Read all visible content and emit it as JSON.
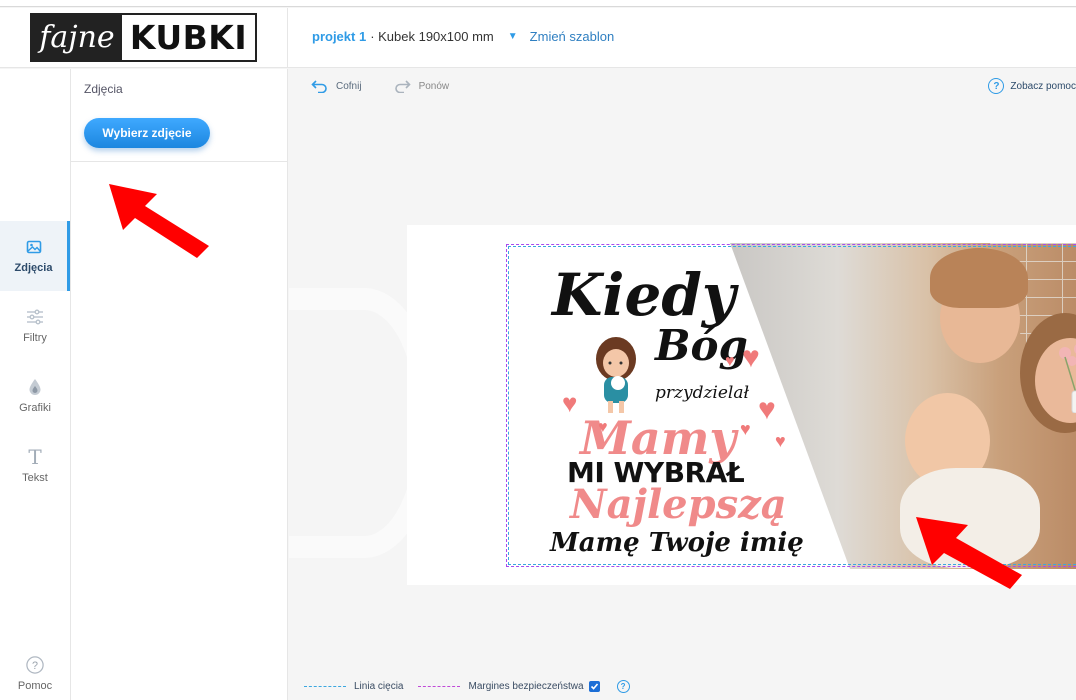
{
  "brand": {
    "logo_left": "fajne",
    "logo_right": "KUBKI"
  },
  "header": {
    "project_name": "projekt 1",
    "product": "· Kubek 190x100 mm",
    "change_template": "Zmień szablon"
  },
  "rail": {
    "items": [
      {
        "label": "Zdjęcia",
        "icon": "image-icon",
        "active": true
      },
      {
        "label": "Filtry",
        "icon": "sliders-icon"
      },
      {
        "label": "Grafiki",
        "icon": "drop-icon"
      },
      {
        "label": "Tekst",
        "icon": "text-icon"
      }
    ],
    "help": {
      "label": "Pomoc",
      "icon": "question-icon"
    }
  },
  "panel": {
    "title": "Zdjęcia",
    "button": "Wybierz zdjęcie"
  },
  "toolbar": {
    "undo": "Cofnij",
    "redo": "Ponów",
    "help": "Zobacz pomoc"
  },
  "design_text": {
    "line1": "Kiedy",
    "line2": "Bóg",
    "line3": "przydzielał",
    "line4": "Mamy",
    "line5": "MI WYBRAŁ",
    "line6": "Najlepszą",
    "line7": "Mamę Twoje imię"
  },
  "legend": {
    "cut_line": "Linia cięcia",
    "safety_margin": "Margines bezpieczeństwa",
    "safety_checked": true
  },
  "colors": {
    "accent": "#2f9be6",
    "pink": "#f08a8a",
    "arrow": "#ff0000",
    "cut": "#3ba7e0",
    "safe": "#a64cf0"
  }
}
